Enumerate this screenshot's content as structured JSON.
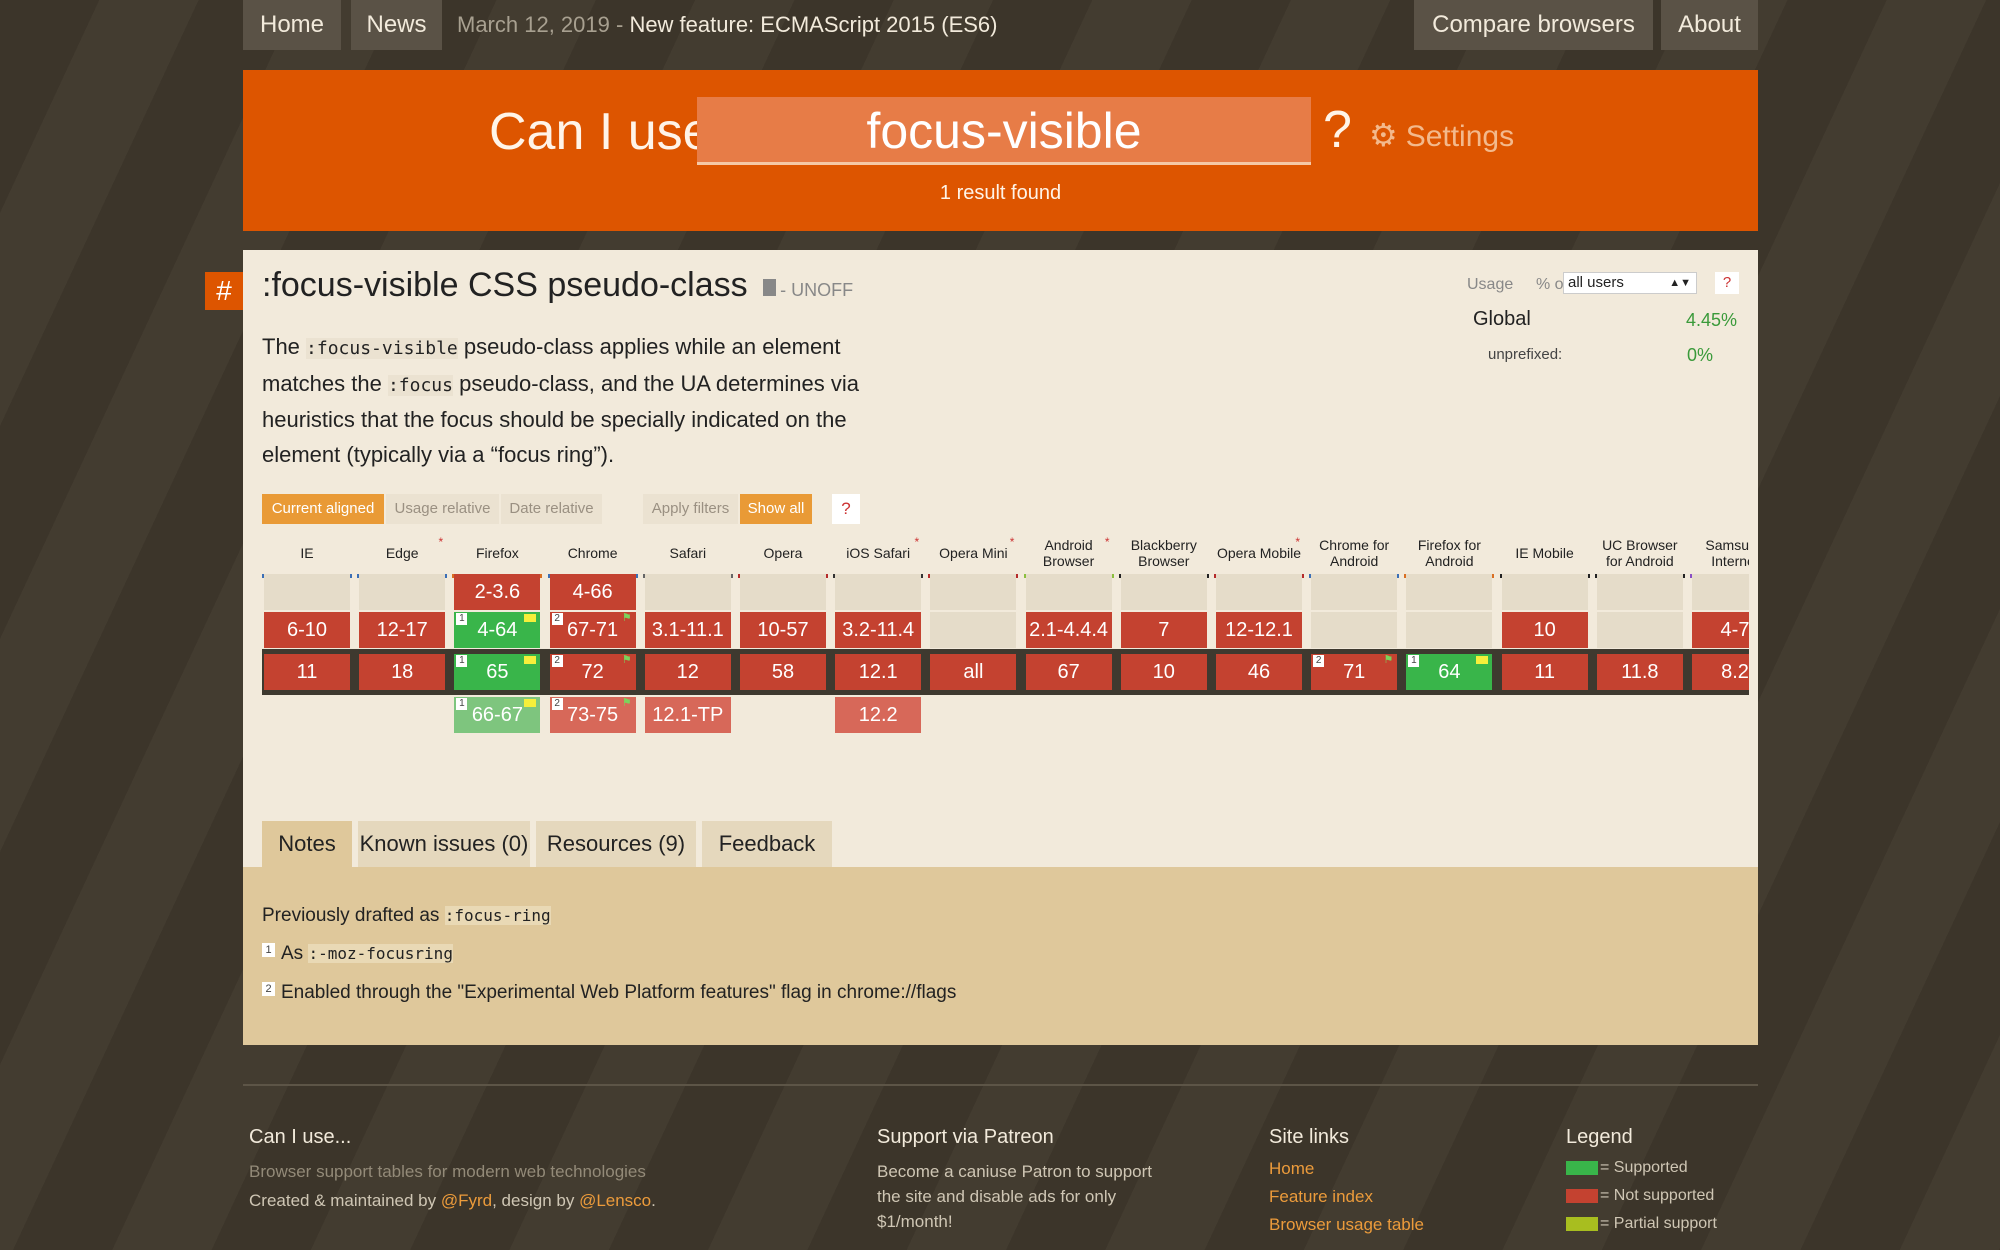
{
  "nav": {
    "home": "Home",
    "news": "News",
    "news_date": "March 12, 2019",
    "news_sep": " - ",
    "news_title": "New feature: ECMAScript 2015 (ES6)",
    "compare": "Compare browsers",
    "about": "About"
  },
  "search": {
    "prefix": "Can I use",
    "query": "focus-visible",
    "qmark": "?",
    "settings": "Settings",
    "result_count": "1 result found"
  },
  "feature": {
    "hash": "#",
    "title": ":focus-visible CSS pseudo-class",
    "status": "- UNOFF",
    "desc_1": "The ",
    "desc_code_1": ":focus-visible",
    "desc_2": " pseudo-class applies while an element matches the ",
    "desc_code_2": ":focus",
    "desc_3": " pseudo-class, and the UA determines via heuristics that the focus should be specially indicated on the element (typically via a “focus ring”)."
  },
  "usage": {
    "label": "Usage",
    "pct_of": "% of",
    "select_value": "all users",
    "help": "?",
    "global_label": "Global",
    "global_value": "4.45%",
    "unprefixed_label": "unprefixed:",
    "unprefixed_value": "0%"
  },
  "filters": {
    "current_aligned": "Current aligned",
    "usage_relative": "Usage relative",
    "date_relative": "Date relative",
    "apply_filters": "Apply filters",
    "show_all": "Show all",
    "help": "?"
  },
  "browsers": [
    {
      "name": "IE",
      "color": "#3b6fb6",
      "star": false
    },
    {
      "name": "Edge",
      "color": "#3b6fb6",
      "star": true
    },
    {
      "name": "Firefox",
      "color": "#d96f23",
      "star": false
    },
    {
      "name": "Chrome",
      "color": "#3b6fb6",
      "star": false
    },
    {
      "name": "Safari",
      "color": "#666666",
      "star": false
    },
    {
      "name": "Opera",
      "color": "#b52b2b",
      "star": false
    },
    {
      "name": "iOS Safari",
      "color": "#333333",
      "star": true
    },
    {
      "name": "Opera Mini",
      "color": "#b52b2b",
      "star": true
    },
    {
      "name": "Android Browser",
      "color": "#8cbf3f",
      "star": true
    },
    {
      "name": "Blackberry Browser",
      "color": "#222222",
      "star": false
    },
    {
      "name": "Opera Mobile",
      "color": "#b52b2b",
      "star": true
    },
    {
      "name": "Chrome for Android",
      "color": "#3b6fb6",
      "star": false
    },
    {
      "name": "Firefox for Android",
      "color": "#d96f23",
      "star": false
    },
    {
      "name": "IE Mobile",
      "color": "#222222",
      "star": false
    },
    {
      "name": "UC Browser for Android",
      "color": "#222222",
      "star": false
    },
    {
      "name": "Samsung Internet",
      "color": "#8a4fc4",
      "star": false
    }
  ],
  "rows": {
    "r1": [
      null,
      null,
      {
        "v": "2-3.6",
        "s": "n"
      },
      {
        "v": "4-66",
        "s": "n"
      },
      null,
      null,
      null,
      null,
      null,
      null,
      null,
      null,
      null,
      null,
      null,
      null
    ],
    "r2": [
      {
        "v": "6-10",
        "s": "n"
      },
      {
        "v": "12-17",
        "s": "n"
      },
      {
        "v": "4-64",
        "s": "y",
        "note": "1",
        "flag": "m"
      },
      {
        "v": "67-71",
        "s": "n",
        "note": "2",
        "flag": "g"
      },
      {
        "v": "3.1-11.1",
        "s": "n"
      },
      {
        "v": "10-57",
        "s": "n"
      },
      {
        "v": "3.2-11.4",
        "s": "n"
      },
      null,
      {
        "v": "2.1-4.4.4",
        "s": "n"
      },
      {
        "v": "7",
        "s": "n"
      },
      {
        "v": "12-12.1",
        "s": "n"
      },
      null,
      null,
      {
        "v": "10",
        "s": "n"
      },
      null,
      {
        "v": "4-7",
        "s": "n"
      }
    ],
    "current": [
      {
        "v": "11",
        "s": "n"
      },
      {
        "v": "18",
        "s": "n"
      },
      {
        "v": "65",
        "s": "y",
        "note": "1",
        "flag": "m"
      },
      {
        "v": "72",
        "s": "n",
        "note": "2",
        "flag": "g"
      },
      {
        "v": "12",
        "s": "n"
      },
      {
        "v": "58",
        "s": "n"
      },
      {
        "v": "12.1",
        "s": "n"
      },
      {
        "v": "all",
        "s": "n"
      },
      {
        "v": "67",
        "s": "n"
      },
      {
        "v": "10",
        "s": "n"
      },
      {
        "v": "46",
        "s": "n"
      },
      {
        "v": "71",
        "s": "n",
        "note": "2",
        "flag": "g"
      },
      {
        "v": "64",
        "s": "y",
        "note": "1",
        "flag": "m"
      },
      {
        "v": "11",
        "s": "n"
      },
      {
        "v": "11.8",
        "s": "n"
      },
      {
        "v": "8.2",
        "s": "n"
      }
    ],
    "future": [
      null,
      null,
      {
        "v": "66-67",
        "s": "py",
        "note": "1",
        "flag": "m"
      },
      {
        "v": "73-75",
        "s": "ny",
        "note": "2",
        "flag": "g"
      },
      {
        "v": "12.1-TP",
        "s": "ny"
      },
      null,
      {
        "v": "12.2",
        "s": "ny"
      },
      null,
      null,
      null,
      null,
      null,
      null,
      null,
      null,
      null
    ]
  },
  "tabs": {
    "notes": "Notes",
    "issues": "Known issues (0)",
    "resources": "Resources (9)",
    "feedback": "Feedback"
  },
  "notes": {
    "line1_text": "Previously drafted as ",
    "line1_code": ":focus-ring",
    "line2_num": "1",
    "line2_text": "As ",
    "line2_code": ":-moz-focusring",
    "line3_num": "2",
    "line3_text": "Enabled through the \"Experimental Web Platform features\" flag in chrome://flags"
  },
  "footer": {
    "col1_title": "Can I use...",
    "col1_tagline": "Browser support tables for modern web technologies",
    "col1_created": "Created & maintained by ",
    "col1_fyrd": "@Fyrd",
    "col1_design": ", design by ",
    "col1_lensco": "@Lensco",
    "col1_end": ".",
    "col2_title": "Support via Patreon",
    "col2_text": "Become a caniuse Patron to support the site and disable ads for only $1/month!",
    "col3_title": "Site links",
    "col3_links": [
      "Home",
      "Feature index",
      "Browser usage table"
    ],
    "col4_title": "Legend",
    "legend": [
      {
        "label": "= Supported",
        "color": "#39b54a"
      },
      {
        "label": "= Not supported",
        "color": "#c44230"
      },
      {
        "label": "= Partial support",
        "color": "#a8be1f"
      }
    ]
  }
}
